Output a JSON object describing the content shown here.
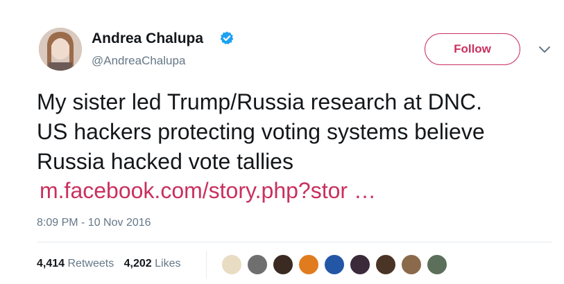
{
  "author": {
    "name": "Andrea Chalupa",
    "handle": "@AndreaChalupa",
    "verified": true
  },
  "follow_label": "Follow",
  "tweet": {
    "lines": [
      "My sister led Trump/Russia research at DNC.",
      "US hackers protecting voting systems believe",
      "Russia hacked vote tallies"
    ],
    "link": "m.facebook.com/story.php?stor …"
  },
  "timestamp": "8:09 PM - 10 Nov 2016",
  "stats": {
    "retweets_count": "4,414",
    "retweets_label": "Retweets",
    "likes_count": "4,202",
    "likes_label": "Likes"
  },
  "colors": {
    "accent": "#c9305e",
    "verified": "#1da1f2",
    "secondary_text": "#657786"
  },
  "liker_avatars": [
    {
      "name": "liker-avatar-1",
      "color": "#e8dcc2"
    },
    {
      "name": "liker-avatar-2",
      "color": "#6f6f6f"
    },
    {
      "name": "liker-avatar-3",
      "color": "#3a2a22"
    },
    {
      "name": "liker-avatar-4",
      "color": "#e07c1e"
    },
    {
      "name": "liker-avatar-5",
      "color": "#2456a6"
    },
    {
      "name": "liker-avatar-6",
      "color": "#3b2a3a"
    },
    {
      "name": "liker-avatar-7",
      "color": "#4a3426"
    },
    {
      "name": "liker-avatar-8",
      "color": "#8a6a4a"
    },
    {
      "name": "liker-avatar-9",
      "color": "#5b6f5a"
    }
  ]
}
